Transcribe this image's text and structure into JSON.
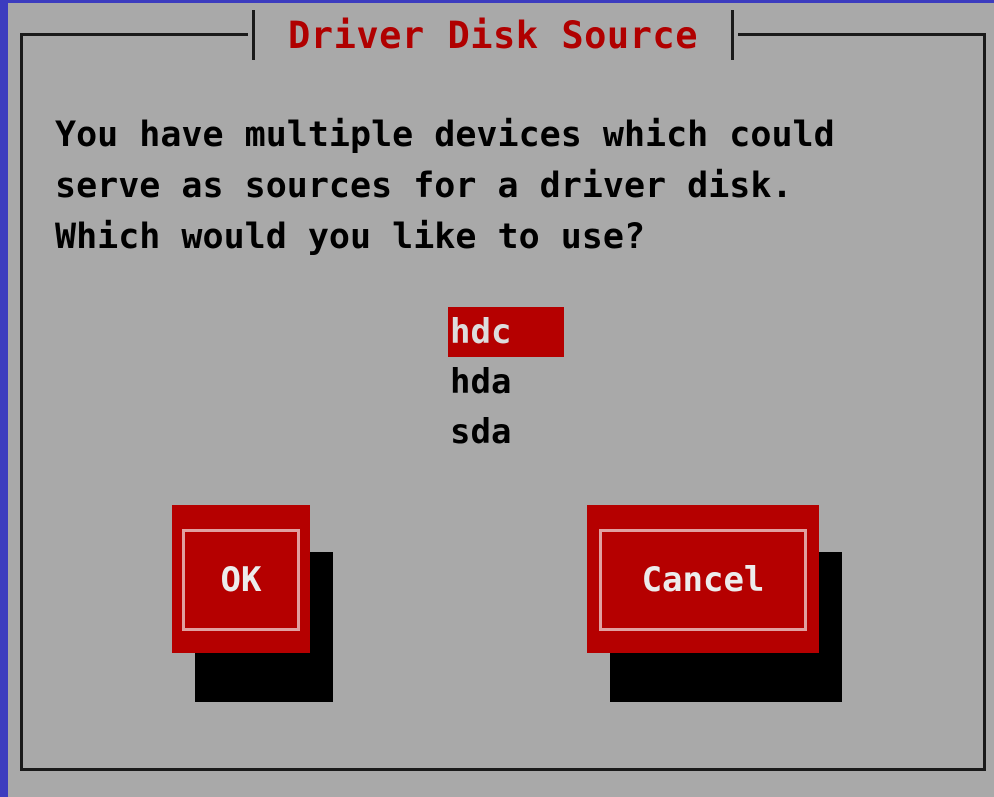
{
  "dialog": {
    "title": "Driver Disk Source",
    "message_lines": [
      "You have multiple devices which could",
      "serve as sources for a driver disk.",
      "Which would you like to use?"
    ]
  },
  "device_list": {
    "items": [
      "hdc",
      "hda",
      "sda"
    ],
    "selected": "hdc"
  },
  "buttons": {
    "ok_label": "OK",
    "cancel_label": "Cancel"
  },
  "colors": {
    "background": "#a9a9a9",
    "accent": "#b50000",
    "title_text": "#b00000",
    "shadow": "#000000",
    "screen_edge": "#3c3cbf"
  }
}
